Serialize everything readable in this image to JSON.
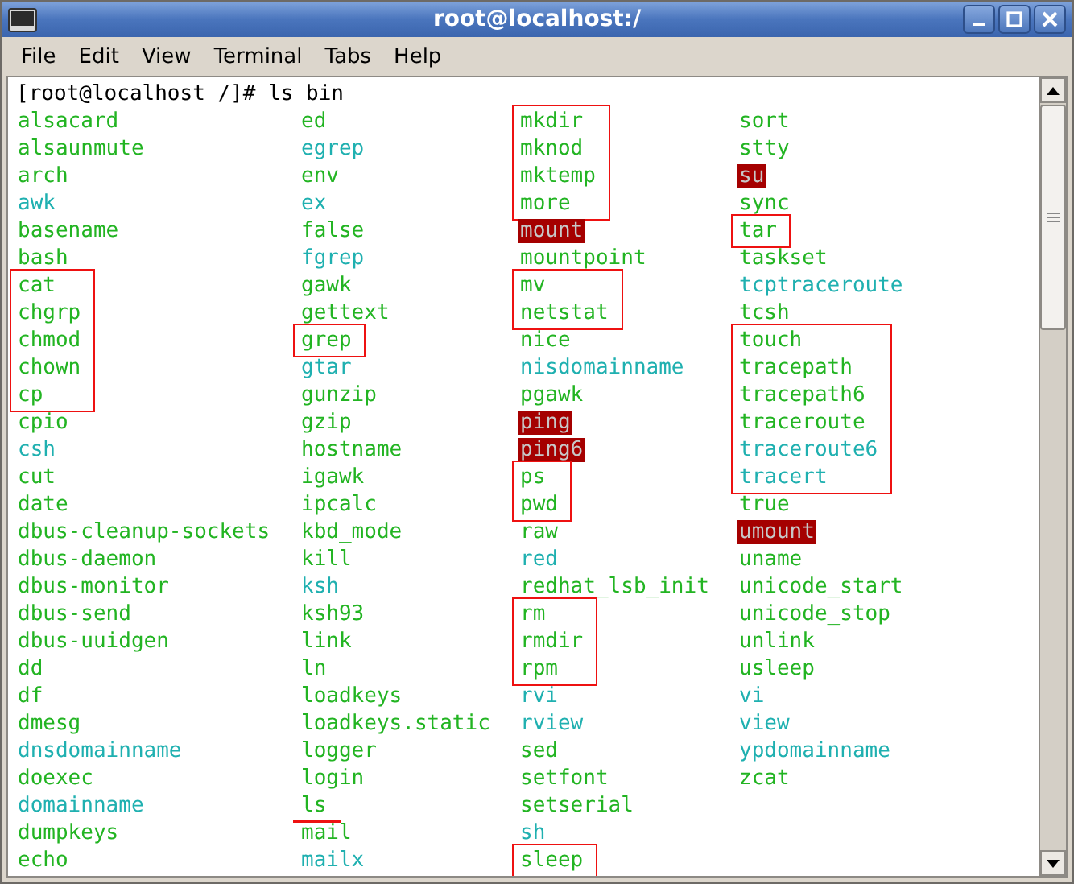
{
  "window": {
    "title": "root@localhost:/"
  },
  "menu": [
    "File",
    "Edit",
    "View",
    "Terminal",
    "Tabs",
    "Help"
  ],
  "terminal": {
    "prompt": "[root@localhost /]# ls bin",
    "columns": [
      [
        {
          "boxed": false,
          "underlined": false,
          "items": [
            {
              "name": "alsacard",
              "kind": "file"
            },
            {
              "name": "alsaunmute",
              "kind": "file"
            },
            {
              "name": "arch",
              "kind": "file"
            },
            {
              "name": "awk",
              "kind": "link"
            },
            {
              "name": "basename",
              "kind": "file"
            },
            {
              "name": "bash",
              "kind": "file"
            }
          ]
        },
        {
          "boxed": true,
          "underlined": false,
          "items": [
            {
              "name": "cat",
              "kind": "file"
            },
            {
              "name": "chgrp",
              "kind": "file"
            },
            {
              "name": "chmod",
              "kind": "file"
            },
            {
              "name": "chown",
              "kind": "file"
            },
            {
              "name": "cp",
              "kind": "file"
            }
          ]
        },
        {
          "boxed": false,
          "underlined": false,
          "items": [
            {
              "name": "cpio",
              "kind": "file"
            },
            {
              "name": "csh",
              "kind": "link"
            },
            {
              "name": "cut",
              "kind": "file"
            },
            {
              "name": "date",
              "kind": "file"
            },
            {
              "name": "dbus-cleanup-sockets",
              "kind": "file"
            },
            {
              "name": "dbus-daemon",
              "kind": "file"
            },
            {
              "name": "dbus-monitor",
              "kind": "file"
            },
            {
              "name": "dbus-send",
              "kind": "file"
            },
            {
              "name": "dbus-uuidgen",
              "kind": "file"
            },
            {
              "name": "dd",
              "kind": "file"
            },
            {
              "name": "df",
              "kind": "file"
            },
            {
              "name": "dmesg",
              "kind": "file"
            },
            {
              "name": "dnsdomainname",
              "kind": "link"
            },
            {
              "name": "doexec",
              "kind": "file"
            },
            {
              "name": "domainname",
              "kind": "link"
            },
            {
              "name": "dumpkeys",
              "kind": "file"
            },
            {
              "name": "echo",
              "kind": "file"
            }
          ]
        }
      ],
      [
        {
          "boxed": false,
          "underlined": false,
          "items": [
            {
              "name": "ed",
              "kind": "file"
            },
            {
              "name": "egrep",
              "kind": "link"
            },
            {
              "name": "env",
              "kind": "file"
            },
            {
              "name": "ex",
              "kind": "link"
            },
            {
              "name": "false",
              "kind": "file"
            },
            {
              "name": "fgrep",
              "kind": "link"
            },
            {
              "name": "gawk",
              "kind": "file"
            },
            {
              "name": "gettext",
              "kind": "file"
            }
          ]
        },
        {
          "boxed": true,
          "underlined": false,
          "items": [
            {
              "name": "grep",
              "kind": "file"
            }
          ]
        },
        {
          "boxed": false,
          "underlined": false,
          "items": [
            {
              "name": "gtar",
              "kind": "link"
            },
            {
              "name": "gunzip",
              "kind": "file"
            },
            {
              "name": "gzip",
              "kind": "file"
            },
            {
              "name": "hostname",
              "kind": "file"
            },
            {
              "name": "igawk",
              "kind": "file"
            },
            {
              "name": "ipcalc",
              "kind": "file"
            },
            {
              "name": "kbd_mode",
              "kind": "file"
            },
            {
              "name": "kill",
              "kind": "file"
            },
            {
              "name": "ksh",
              "kind": "link"
            },
            {
              "name": "ksh93",
              "kind": "file"
            },
            {
              "name": "link",
              "kind": "file"
            },
            {
              "name": "ln",
              "kind": "file"
            },
            {
              "name": "loadkeys",
              "kind": "file"
            },
            {
              "name": "loadkeys.static",
              "kind": "file"
            },
            {
              "name": "logger",
              "kind": "file"
            },
            {
              "name": "login",
              "kind": "file"
            }
          ]
        },
        {
          "boxed": false,
          "underlined": true,
          "items": [
            {
              "name": "ls",
              "kind": "file"
            }
          ]
        },
        {
          "boxed": false,
          "underlined": false,
          "items": [
            {
              "name": "mail",
              "kind": "file"
            },
            {
              "name": "mailx",
              "kind": "link"
            }
          ]
        }
      ],
      [
        {
          "boxed": true,
          "underlined": false,
          "items": [
            {
              "name": "mkdir",
              "kind": "file"
            },
            {
              "name": "mknod",
              "kind": "file"
            },
            {
              "name": "mktemp",
              "kind": "file"
            },
            {
              "name": "more",
              "kind": "file"
            }
          ]
        },
        {
          "boxed": false,
          "underlined": false,
          "items": [
            {
              "name": "mount",
              "kind": "setuid"
            },
            {
              "name": "mountpoint",
              "kind": "file"
            }
          ]
        },
        {
          "boxed": true,
          "underlined": false,
          "items": [
            {
              "name": "mv",
              "kind": "file"
            },
            {
              "name": "netstat",
              "kind": "file"
            }
          ]
        },
        {
          "boxed": false,
          "underlined": false,
          "items": [
            {
              "name": "nice",
              "kind": "file"
            },
            {
              "name": "nisdomainname",
              "kind": "link"
            },
            {
              "name": "pgawk",
              "kind": "file"
            },
            {
              "name": "ping",
              "kind": "setuid"
            },
            {
              "name": "ping6",
              "kind": "setuid"
            }
          ]
        },
        {
          "boxed": true,
          "underlined": false,
          "items": [
            {
              "name": "ps",
              "kind": "file"
            },
            {
              "name": "pwd",
              "kind": "file"
            }
          ]
        },
        {
          "boxed": false,
          "underlined": false,
          "items": [
            {
              "name": "raw",
              "kind": "file"
            },
            {
              "name": "red",
              "kind": "link"
            },
            {
              "name": "redhat_lsb_init",
              "kind": "file"
            }
          ]
        },
        {
          "boxed": true,
          "underlined": false,
          "items": [
            {
              "name": "rm",
              "kind": "file"
            },
            {
              "name": "rmdir",
              "kind": "file"
            },
            {
              "name": "rpm",
              "kind": "file"
            }
          ]
        },
        {
          "boxed": false,
          "underlined": false,
          "items": [
            {
              "name": "rvi",
              "kind": "link"
            },
            {
              "name": "rview",
              "kind": "link"
            },
            {
              "name": "sed",
              "kind": "file"
            },
            {
              "name": "setfont",
              "kind": "file"
            },
            {
              "name": "setserial",
              "kind": "file"
            },
            {
              "name": "sh",
              "kind": "link"
            }
          ]
        },
        {
          "boxed": true,
          "underlined": false,
          "items": [
            {
              "name": "sleep",
              "kind": "file"
            }
          ]
        }
      ],
      [
        {
          "boxed": false,
          "underlined": false,
          "items": [
            {
              "name": "sort",
              "kind": "file"
            },
            {
              "name": "stty",
              "kind": "file"
            },
            {
              "name": "su",
              "kind": "setuid"
            },
            {
              "name": "sync",
              "kind": "file"
            }
          ]
        },
        {
          "boxed": true,
          "underlined": false,
          "items": [
            {
              "name": "tar",
              "kind": "file"
            }
          ]
        },
        {
          "boxed": false,
          "underlined": false,
          "items": [
            {
              "name": "taskset",
              "kind": "file"
            },
            {
              "name": "tcptraceroute",
              "kind": "link"
            },
            {
              "name": "tcsh",
              "kind": "file"
            }
          ]
        },
        {
          "boxed": true,
          "underlined": false,
          "items": [
            {
              "name": "touch",
              "kind": "file"
            },
            {
              "name": "tracepath",
              "kind": "file"
            },
            {
              "name": "tracepath6",
              "kind": "file"
            },
            {
              "name": "traceroute",
              "kind": "file"
            },
            {
              "name": "traceroute6",
              "kind": "link"
            },
            {
              "name": "tracert",
              "kind": "link"
            }
          ]
        },
        {
          "boxed": false,
          "underlined": false,
          "items": [
            {
              "name": "true",
              "kind": "file"
            },
            {
              "name": "umount",
              "kind": "setuid"
            },
            {
              "name": "uname",
              "kind": "file"
            },
            {
              "name": "unicode_start",
              "kind": "file"
            },
            {
              "name": "unicode_stop",
              "kind": "file"
            },
            {
              "name": "unlink",
              "kind": "file"
            },
            {
              "name": "usleep",
              "kind": "file"
            },
            {
              "name": "vi",
              "kind": "link"
            },
            {
              "name": "view",
              "kind": "link"
            },
            {
              "name": "ypdomainname",
              "kind": "link"
            },
            {
              "name": "zcat",
              "kind": "file"
            }
          ]
        }
      ]
    ]
  }
}
